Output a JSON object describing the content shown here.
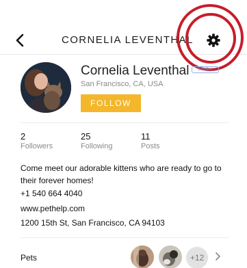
{
  "header": {
    "title": "CORNELIA LEVENTHAL",
    "back_icon": "chevron-left-icon",
    "settings_icon": "gear-icon"
  },
  "profile": {
    "name": "Cornelia Leventhal",
    "badge": "Shelter",
    "location": "San Francisco, CA, USA",
    "follow_label": "FOLLOW"
  },
  "stats": [
    {
      "value": "2",
      "label": "Followers"
    },
    {
      "value": "25",
      "label": "Following"
    },
    {
      "value": "11",
      "label": "Posts"
    }
  ],
  "bio": "Come meet our adorable kittens who are ready to go to their forever homes!",
  "contact": {
    "phone": "+1 540 664 4040",
    "website": "www.pethelp.com",
    "address": "1200 15th St, San Francisco, CA 94103"
  },
  "pets": {
    "label": "Pets",
    "more_count": "+12"
  },
  "colors": {
    "accent": "#f4b62a",
    "annotation_ring": "#c61d2a",
    "badge": "#6d95cf"
  }
}
